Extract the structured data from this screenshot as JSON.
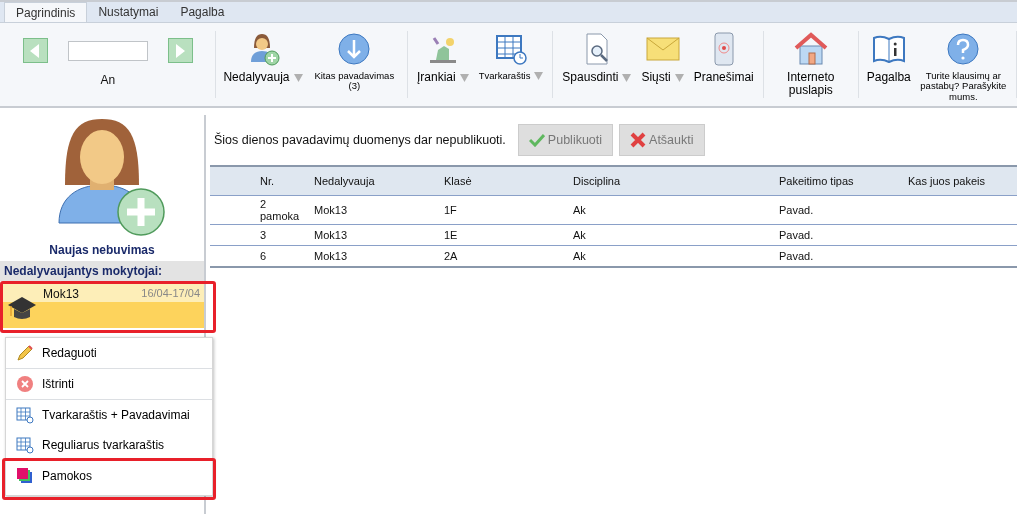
{
  "tabs": [
    {
      "label": "Pagrindinis",
      "selected": true
    },
    {
      "label": "Nustatymai",
      "selected": false
    },
    {
      "label": "Pagalba",
      "selected": false
    }
  ],
  "navigator": {
    "label": "An"
  },
  "ribbon_groups": [
    {
      "items": [
        {
          "kind": "person-add",
          "label": "Nedalyvauja",
          "dropdown": true
        },
        {
          "kind": "arrow-down",
          "label": "Kitas pavadavimas (3)",
          "dropdown": false
        }
      ]
    },
    {
      "items": [
        {
          "kind": "tools",
          "label": "Įrankiai",
          "dropdown": true
        },
        {
          "kind": "schedule",
          "label": "Tvarkaraštis",
          "dropdown": true
        }
      ]
    },
    {
      "items": [
        {
          "kind": "print",
          "label": "Spausdinti",
          "dropdown": true
        },
        {
          "kind": "mail",
          "label": "Siųsti",
          "dropdown": true
        },
        {
          "kind": "phone",
          "label": "Pranešimai",
          "dropdown": false
        }
      ]
    },
    {
      "items": [
        {
          "kind": "house",
          "label": "Interneto puslapis",
          "dropdown": false
        }
      ]
    },
    {
      "items": [
        {
          "kind": "book",
          "label": "Pagalba",
          "dropdown": false
        },
        {
          "kind": "question",
          "label": "Turite klausimų ar pastabų? Parašykite mums.",
          "dropdown": false
        }
      ]
    }
  ],
  "new_absence": {
    "label": "Naujas nebuvimas"
  },
  "absent_teachers": {
    "title": "Nedalyvaujantys mokytojai:",
    "items": [
      {
        "name": "Mok13",
        "dates": "16/04-17/04",
        "selected": true,
        "highlighted": true
      }
    ]
  },
  "context_menu": {
    "groups": [
      [
        {
          "kind": "pencil",
          "label": "Redaguoti",
          "highlighted": false
        }
      ],
      [
        {
          "kind": "delete",
          "label": "Ištrinti",
          "highlighted": false
        }
      ],
      [
        {
          "kind": "schedule",
          "label": "Tvarkaraštis + Pavadavimai",
          "highlighted": false
        },
        {
          "kind": "schedule",
          "label": "Reguliarus tvarkaraštis",
          "highlighted": false
        }
      ],
      [
        {
          "kind": "lessons",
          "label": "Pamokos",
          "highlighted": true
        }
      ]
    ]
  },
  "notice": {
    "text": "Šios dienos pavadavimų duomenys dar nepublikuoti.",
    "buttons": [
      {
        "kind": "check",
        "label": "Publikuoti",
        "disabled": true
      },
      {
        "kind": "cross",
        "label": "Atšaukti",
        "disabled": true
      }
    ]
  },
  "table": {
    "columns": [
      "Nr.",
      "Nedalyvauja",
      "Klasė",
      "Disciplina",
      "Pakeitimo tipas",
      "Kas juos pakeis"
    ],
    "rows": [
      [
        "2 pamoka",
        "Mok13",
        "1F",
        "Ak",
        "Pavad.",
        ""
      ],
      [
        "3",
        "Mok13",
        "1E",
        "Ak",
        "Pavad.",
        ""
      ],
      [
        "6",
        "Mok13",
        "2A",
        "Ak",
        "Pavad.",
        ""
      ]
    ]
  }
}
